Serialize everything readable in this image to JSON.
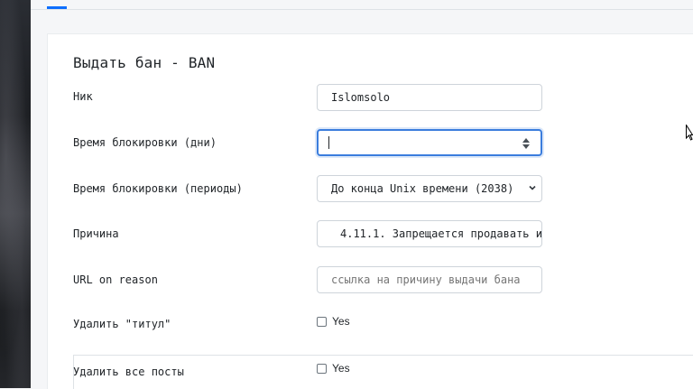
{
  "form": {
    "title": "Выдать бан - BAN",
    "nick": {
      "label": "Ник",
      "value": "Islomsolo"
    },
    "ban_days": {
      "label": "Время блокировки (дни)",
      "value": ""
    },
    "ban_period": {
      "label": "Время блокировки (периоды)",
      "selected": "До конца Unix времени (2038)"
    },
    "reason": {
      "label": "Причина",
      "selected": "4.11.1. Запрещается продавать и"
    },
    "url_reason": {
      "label": "URL on reason",
      "placeholder": "ссылка на причину выдачи бана"
    },
    "remove_title": {
      "label": "Удалить \"титул\"",
      "option": "Yes",
      "checked": false
    },
    "remove_posts": {
      "label": "Удалить все посты",
      "option": "Yes",
      "checked": false
    }
  },
  "colors": {
    "accent": "#0d6efd",
    "focus_border": "#3b7ddd",
    "background": "#f5f6f8",
    "card": "#ffffff"
  },
  "icons": {
    "spinner": "number-spinner-icon",
    "select": "chevron-down-icon",
    "cursor": "mouse-pointer-icon"
  }
}
